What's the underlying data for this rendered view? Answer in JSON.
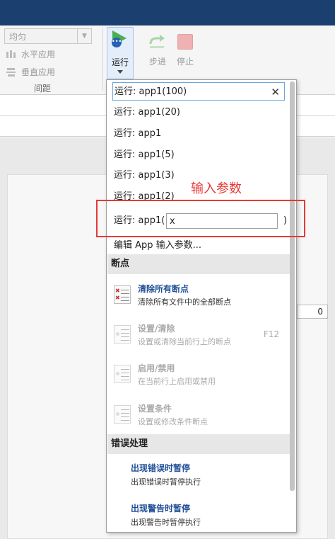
{
  "ribbon": {
    "spacing_select": "均匀",
    "horizontal_apply": "水平应用",
    "vertical_apply": "垂直应用",
    "group_label": "间距",
    "run_label": "运行",
    "step_label": "步进",
    "stop_label": "停止"
  },
  "run_menu": {
    "items": [
      "运行: app1(100)",
      "运行: app1(20)",
      "运行: app1",
      "运行: app1(5)",
      "运行: app1(3)",
      "运行: app1(2)"
    ],
    "param_prefix": "运行: app1(",
    "param_value": "x",
    "param_suffix": ")",
    "edit_params": "编辑 App 输入参数..."
  },
  "breakpoints": {
    "header": "断点",
    "items": [
      {
        "title": "清除所有断点",
        "desc": "清除所有文件中的全部断点",
        "shortcut": ""
      },
      {
        "title": "设置/清除",
        "desc": "设置或清除当前行上的断点",
        "shortcut": "F12"
      },
      {
        "title": "启用/禁用",
        "desc": "在当前行上启用或禁用",
        "shortcut": ""
      },
      {
        "title": "设置条件",
        "desc": "设置或修改条件断点",
        "shortcut": ""
      }
    ]
  },
  "error_handling": {
    "header": "错误处理",
    "items": [
      {
        "title": "出现错误时暂停",
        "desc": "出现错误时暂停执行"
      },
      {
        "title": "出现警告时暂停",
        "desc": "出现警告时暂停执行"
      }
    ]
  },
  "annotation": "输入参数",
  "background_value": "0",
  "colors": {
    "titlebar": "#1b3f6e",
    "annotation_red": "#e53935",
    "link_blue": "#1f4e97",
    "selection_border": "#6ea6e0"
  }
}
